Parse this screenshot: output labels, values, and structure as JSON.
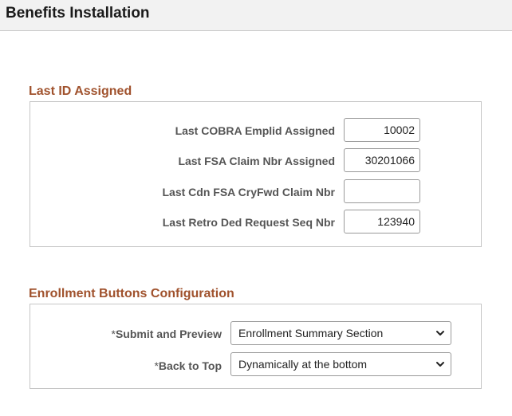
{
  "page": {
    "title": "Benefits Installation"
  },
  "last_id_section": {
    "title": "Last ID Assigned",
    "fields": [
      {
        "label": "Last COBRA Emplid Assigned",
        "value": "10002"
      },
      {
        "label": "Last FSA Claim Nbr Assigned",
        "value": "30201066"
      },
      {
        "label": "Last Cdn FSA CryFwd Claim Nbr",
        "value": ""
      },
      {
        "label": "Last Retro Ded Request Seq Nbr",
        "value": "123940"
      }
    ]
  },
  "enrollment_section": {
    "title": "Enrollment Buttons Configuration",
    "required_marker": "*",
    "fields": [
      {
        "label": "Submit and Preview",
        "value": "Enrollment Summary Section"
      },
      {
        "label": "Back to Top",
        "value": "Dynamically at the bottom"
      }
    ]
  }
}
